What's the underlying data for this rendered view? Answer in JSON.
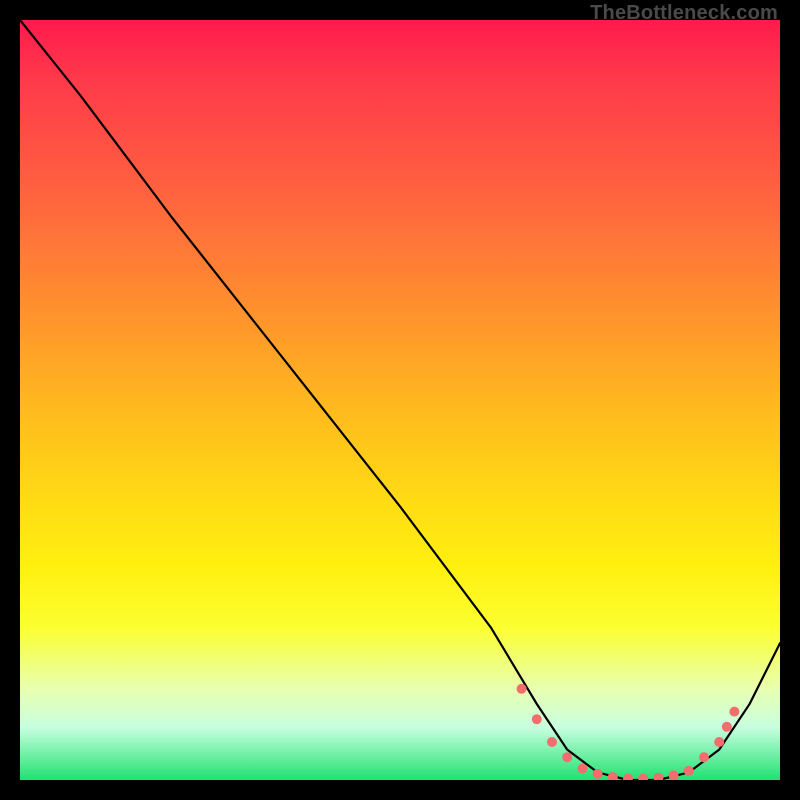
{
  "attribution": "TheBottleneck.com",
  "chart_data": {
    "type": "line",
    "title": "",
    "xlabel": "",
    "ylabel": "",
    "xlim": [
      0,
      100
    ],
    "ylim": [
      0,
      100
    ],
    "grid": false,
    "legend": false,
    "background_gradient": [
      "#ff1a4d",
      "#ffb61f",
      "#fff010",
      "#20e270"
    ],
    "series": [
      {
        "name": "bottleneck-curve",
        "color": "#000000",
        "x": [
          0,
          8,
          20,
          35,
          50,
          62,
          68,
          72,
          76,
          80,
          84,
          88,
          92,
          96,
          100
        ],
        "y": [
          100,
          90,
          74,
          55,
          36,
          20,
          10,
          4,
          1,
          0,
          0,
          1,
          4,
          10,
          18
        ]
      }
    ],
    "markers": {
      "name": "highlight-points",
      "color": "#f26d6d",
      "radius": 5,
      "x": [
        66,
        68,
        70,
        72,
        74,
        76,
        78,
        80,
        82,
        84,
        86,
        88,
        90,
        92,
        93,
        94
      ],
      "y": [
        12,
        8,
        5,
        3,
        1.5,
        0.8,
        0.4,
        0.2,
        0.2,
        0.3,
        0.6,
        1.2,
        3,
        5,
        7,
        9
      ]
    }
  }
}
